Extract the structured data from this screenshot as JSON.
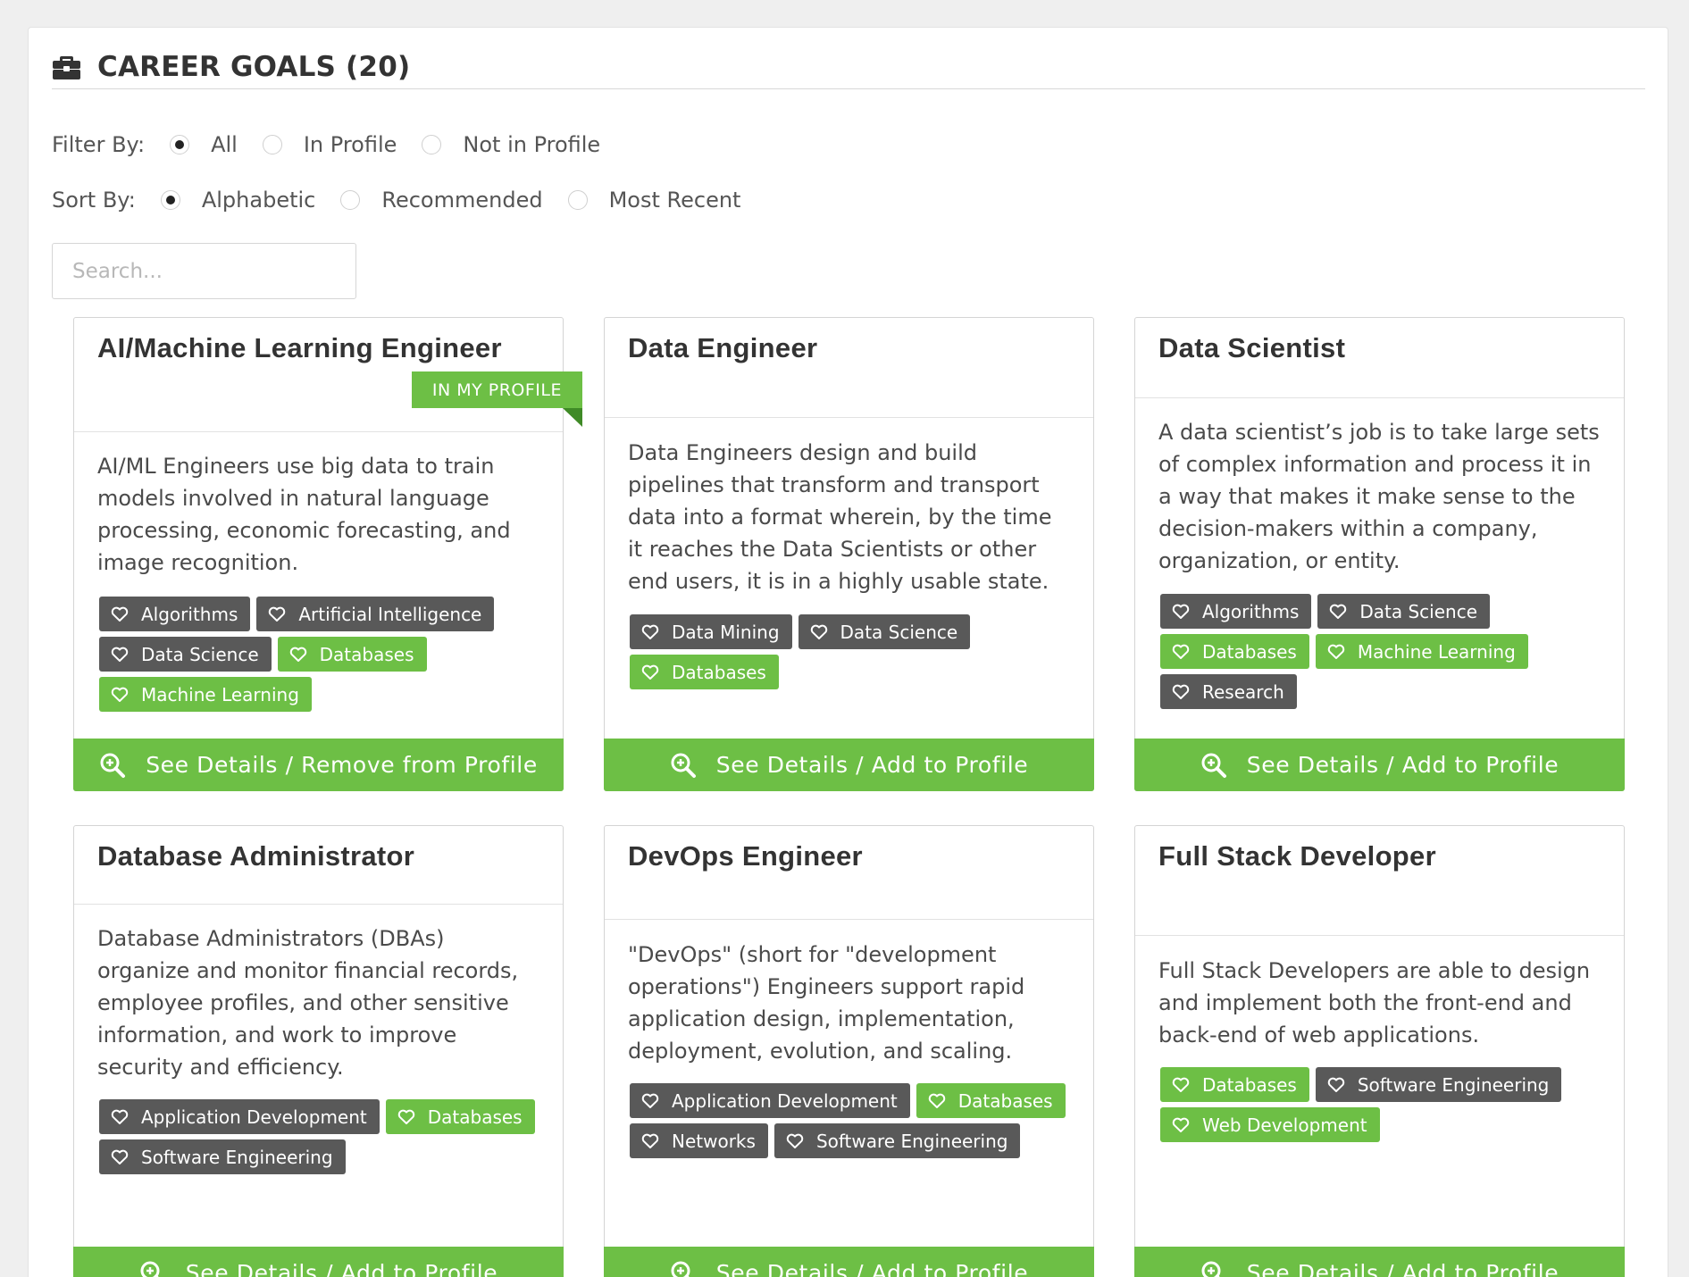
{
  "header": {
    "title": "CAREER GOALS (20)"
  },
  "filter": {
    "label": "Filter By:",
    "options": [
      {
        "label": "All",
        "selected": true
      },
      {
        "label": "In Profile",
        "selected": false
      },
      {
        "label": "Not in Profile",
        "selected": false
      }
    ]
  },
  "sort": {
    "label": "Sort By:",
    "options": [
      {
        "label": "Alphabetic",
        "selected": true
      },
      {
        "label": "Recommended",
        "selected": false
      },
      {
        "label": "Most Recent",
        "selected": false
      }
    ]
  },
  "search": {
    "placeholder": "Search...",
    "value": ""
  },
  "colors": {
    "accent": "#6dbf45",
    "tag_dark": "#595959"
  },
  "cards": [
    {
      "title": "AI/Machine Learning Engineer",
      "badge": "IN MY PROFILE",
      "description": "AI/ML Engineers use big data to train models involved in natural language processing, economic forecasting, and image recognition.",
      "tags": [
        {
          "label": "Algorithms",
          "in_profile": false
        },
        {
          "label": "Artificial Intelligence",
          "in_profile": false
        },
        {
          "label": "Data Science",
          "in_profile": false
        },
        {
          "label": "Databases",
          "in_profile": true
        },
        {
          "label": "Machine Learning",
          "in_profile": true
        }
      ],
      "action": "See Details / Remove from Profile"
    },
    {
      "title": "Data Engineer",
      "description": "Data Engineers design and build pipelines that transform and transport data into a format wherein, by the time it reaches the Data Scientists or other end users, it is in a highly usable state.",
      "tags": [
        {
          "label": "Data Mining",
          "in_profile": false
        },
        {
          "label": "Data Science",
          "in_profile": false
        },
        {
          "label": "Databases",
          "in_profile": true
        }
      ],
      "action": "See Details / Add to Profile"
    },
    {
      "title": "Data Scientist",
      "description": "A data scientist’s job is to take large sets of complex information and process it in a way that makes it make sense to the decision-makers within a company, organization, or entity.",
      "tags": [
        {
          "label": "Algorithms",
          "in_profile": false
        },
        {
          "label": "Data Science",
          "in_profile": false
        },
        {
          "label": "Databases",
          "in_profile": true
        },
        {
          "label": "Machine Learning",
          "in_profile": true
        },
        {
          "label": "Research",
          "in_profile": false
        }
      ],
      "action": "See Details / Add to Profile"
    },
    {
      "title": "Database Administrator",
      "description": "Database Administrators (DBAs) organize and monitor financial records, employee profiles, and other sensitive information, and work to improve security and efficiency.",
      "tags": [
        {
          "label": "Application Development",
          "in_profile": false
        },
        {
          "label": "Databases",
          "in_profile": true
        },
        {
          "label": "Software Engineering",
          "in_profile": false
        }
      ],
      "action": "See Details / Add to Profile"
    },
    {
      "title": "DevOps Engineer",
      "description": "\"DevOps\" (short for \"development operations\") Engineers support rapid application design, implementation, deployment, evolution, and scaling.",
      "tags": [
        {
          "label": "Application Development",
          "in_profile": false
        },
        {
          "label": "Databases",
          "in_profile": true
        },
        {
          "label": "Networks",
          "in_profile": false
        },
        {
          "label": "Software Engineering",
          "in_profile": false
        }
      ],
      "action": "See Details / Add to Profile"
    },
    {
      "title": "Full Stack Developer",
      "description": "Full Stack Developers are able to design and implement both the front-end and back-end of web applications.",
      "tags": [
        {
          "label": "Databases",
          "in_profile": true
        },
        {
          "label": "Software Engineering",
          "in_profile": false
        },
        {
          "label": "Web Development",
          "in_profile": true
        }
      ],
      "action": "See Details / Add to Profile"
    }
  ]
}
